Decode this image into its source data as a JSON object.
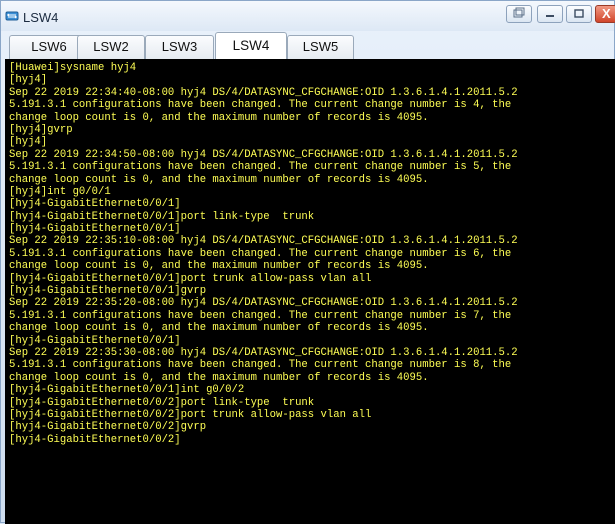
{
  "window": {
    "title": "LSW4",
    "close_glyph": "X"
  },
  "tabs": [
    {
      "label": "LSW6"
    },
    {
      "label": "LSW2"
    },
    {
      "label": "LSW3"
    },
    {
      "label": "LSW4",
      "active": true
    },
    {
      "label": "LSW5"
    }
  ],
  "colors": {
    "terminal_bg": "#000000",
    "terminal_text": "#ffff55",
    "close_button": "#d1452b"
  },
  "terminal": {
    "lines": [
      "[Huawei]sysname hyj4",
      "[hyj4]",
      "Sep 22 2019 22:34:40-08:00 hyj4 DS/4/DATASYNC_CFGCHANGE:OID 1.3.6.1.4.1.2011.5.2",
      "5.191.3.1 configurations have been changed. The current change number is 4, the",
      "change loop count is 0, and the maximum number of records is 4095.",
      "[hyj4]gvrp",
      "[hyj4]",
      "Sep 22 2019 22:34:50-08:00 hyj4 DS/4/DATASYNC_CFGCHANGE:OID 1.3.6.1.4.1.2011.5.2",
      "5.191.3.1 configurations have been changed. The current change number is 5, the",
      "change loop count is 0, and the maximum number of records is 4095.",
      "[hyj4]int g0/0/1",
      "[hyj4-GigabitEthernet0/0/1]",
      "[hyj4-GigabitEthernet0/0/1]port link-type  trunk",
      "[hyj4-GigabitEthernet0/0/1]",
      "Sep 22 2019 22:35:10-08:00 hyj4 DS/4/DATASYNC_CFGCHANGE:OID 1.3.6.1.4.1.2011.5.2",
      "5.191.3.1 configurations have been changed. The current change number is 6, the",
      "change loop count is 0, and the maximum number of records is 4095.",
      "[hyj4-GigabitEthernet0/0/1]port trunk allow-pass vlan all",
      "[hyj4-GigabitEthernet0/0/1]gvrp",
      "Sep 22 2019 22:35:20-08:00 hyj4 DS/4/DATASYNC_CFGCHANGE:OID 1.3.6.1.4.1.2011.5.2",
      "5.191.3.1 configurations have been changed. The current change number is 7, the",
      "change loop count is 0, and the maximum number of records is 4095.",
      "[hyj4-GigabitEthernet0/0/1]",
      "Sep 22 2019 22:35:30-08:00 hyj4 DS/4/DATASYNC_CFGCHANGE:OID 1.3.6.1.4.1.2011.5.2",
      "5.191.3.1 configurations have been changed. The current change number is 8, the",
      "change loop count is 0, and the maximum number of records is 4095.",
      "[hyj4-GigabitEthernet0/0/1]int g0/0/2",
      "[hyj4-GigabitEthernet0/0/2]port link-type  trunk",
      "[hyj4-GigabitEthernet0/0/2]port trunk allow-pass vlan all",
      "[hyj4-GigabitEthernet0/0/2]gvrp",
      "[hyj4-GigabitEthernet0/0/2]"
    ]
  }
}
